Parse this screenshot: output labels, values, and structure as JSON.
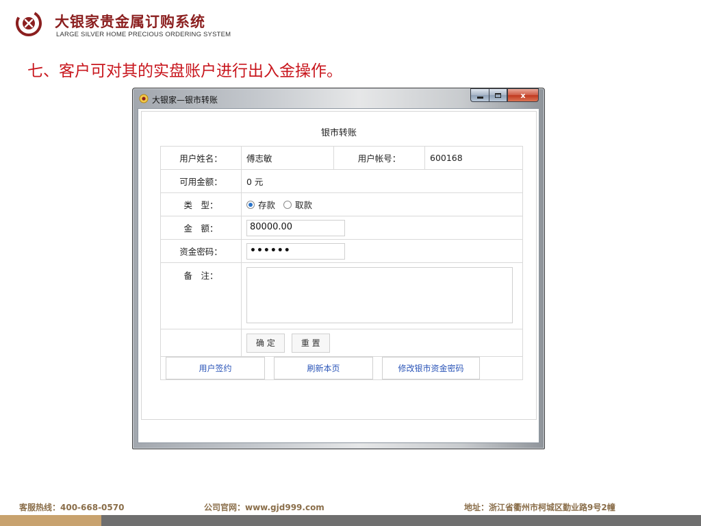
{
  "slide": {
    "logo_title": "大银家贵金属订购系统",
    "logo_subtitle": "LARGE SILVER HOME PRECIOUS ORDERING SYSTEM",
    "step_title": "七、客户可对其的实盘账户进行出入金操作。"
  },
  "window": {
    "title": "大银家—银市转账",
    "controls": {
      "minimize": "—",
      "maximize": "□",
      "close": "x"
    }
  },
  "form": {
    "title": "银市转账",
    "user_name_label": "用户姓名：",
    "user_name_value": "傅志敏",
    "account_label": "用户帐号：",
    "account_value": "600168",
    "balance_label": "可用金额：",
    "balance_value": "0 元",
    "type_label": "类　型：",
    "type_options": [
      "存款",
      "取款"
    ],
    "type_selected": "存款",
    "amount_label": "金　额：",
    "amount_value": "80000.00",
    "password_label": "资金密码：",
    "password_value": "••••••",
    "remark_label": "备　注：",
    "remark_value": "",
    "confirm_button": "确 定",
    "reset_button": "重 置"
  },
  "nav_buttons": [
    "用户签约",
    "刷新本页",
    "修改银市资金密码"
  ],
  "footer": {
    "hotline": "客服热线：400-668-0570",
    "website": "公司官网：www.gjd999.com",
    "address": "地址：浙江省衢州市柯城区勤业路9号2幢"
  },
  "colors": {
    "brand_red": "#c8161d",
    "logo_red": "#8b1f1f",
    "link_blue": "#2b55b8",
    "footer_gold": "#c8a26e"
  }
}
